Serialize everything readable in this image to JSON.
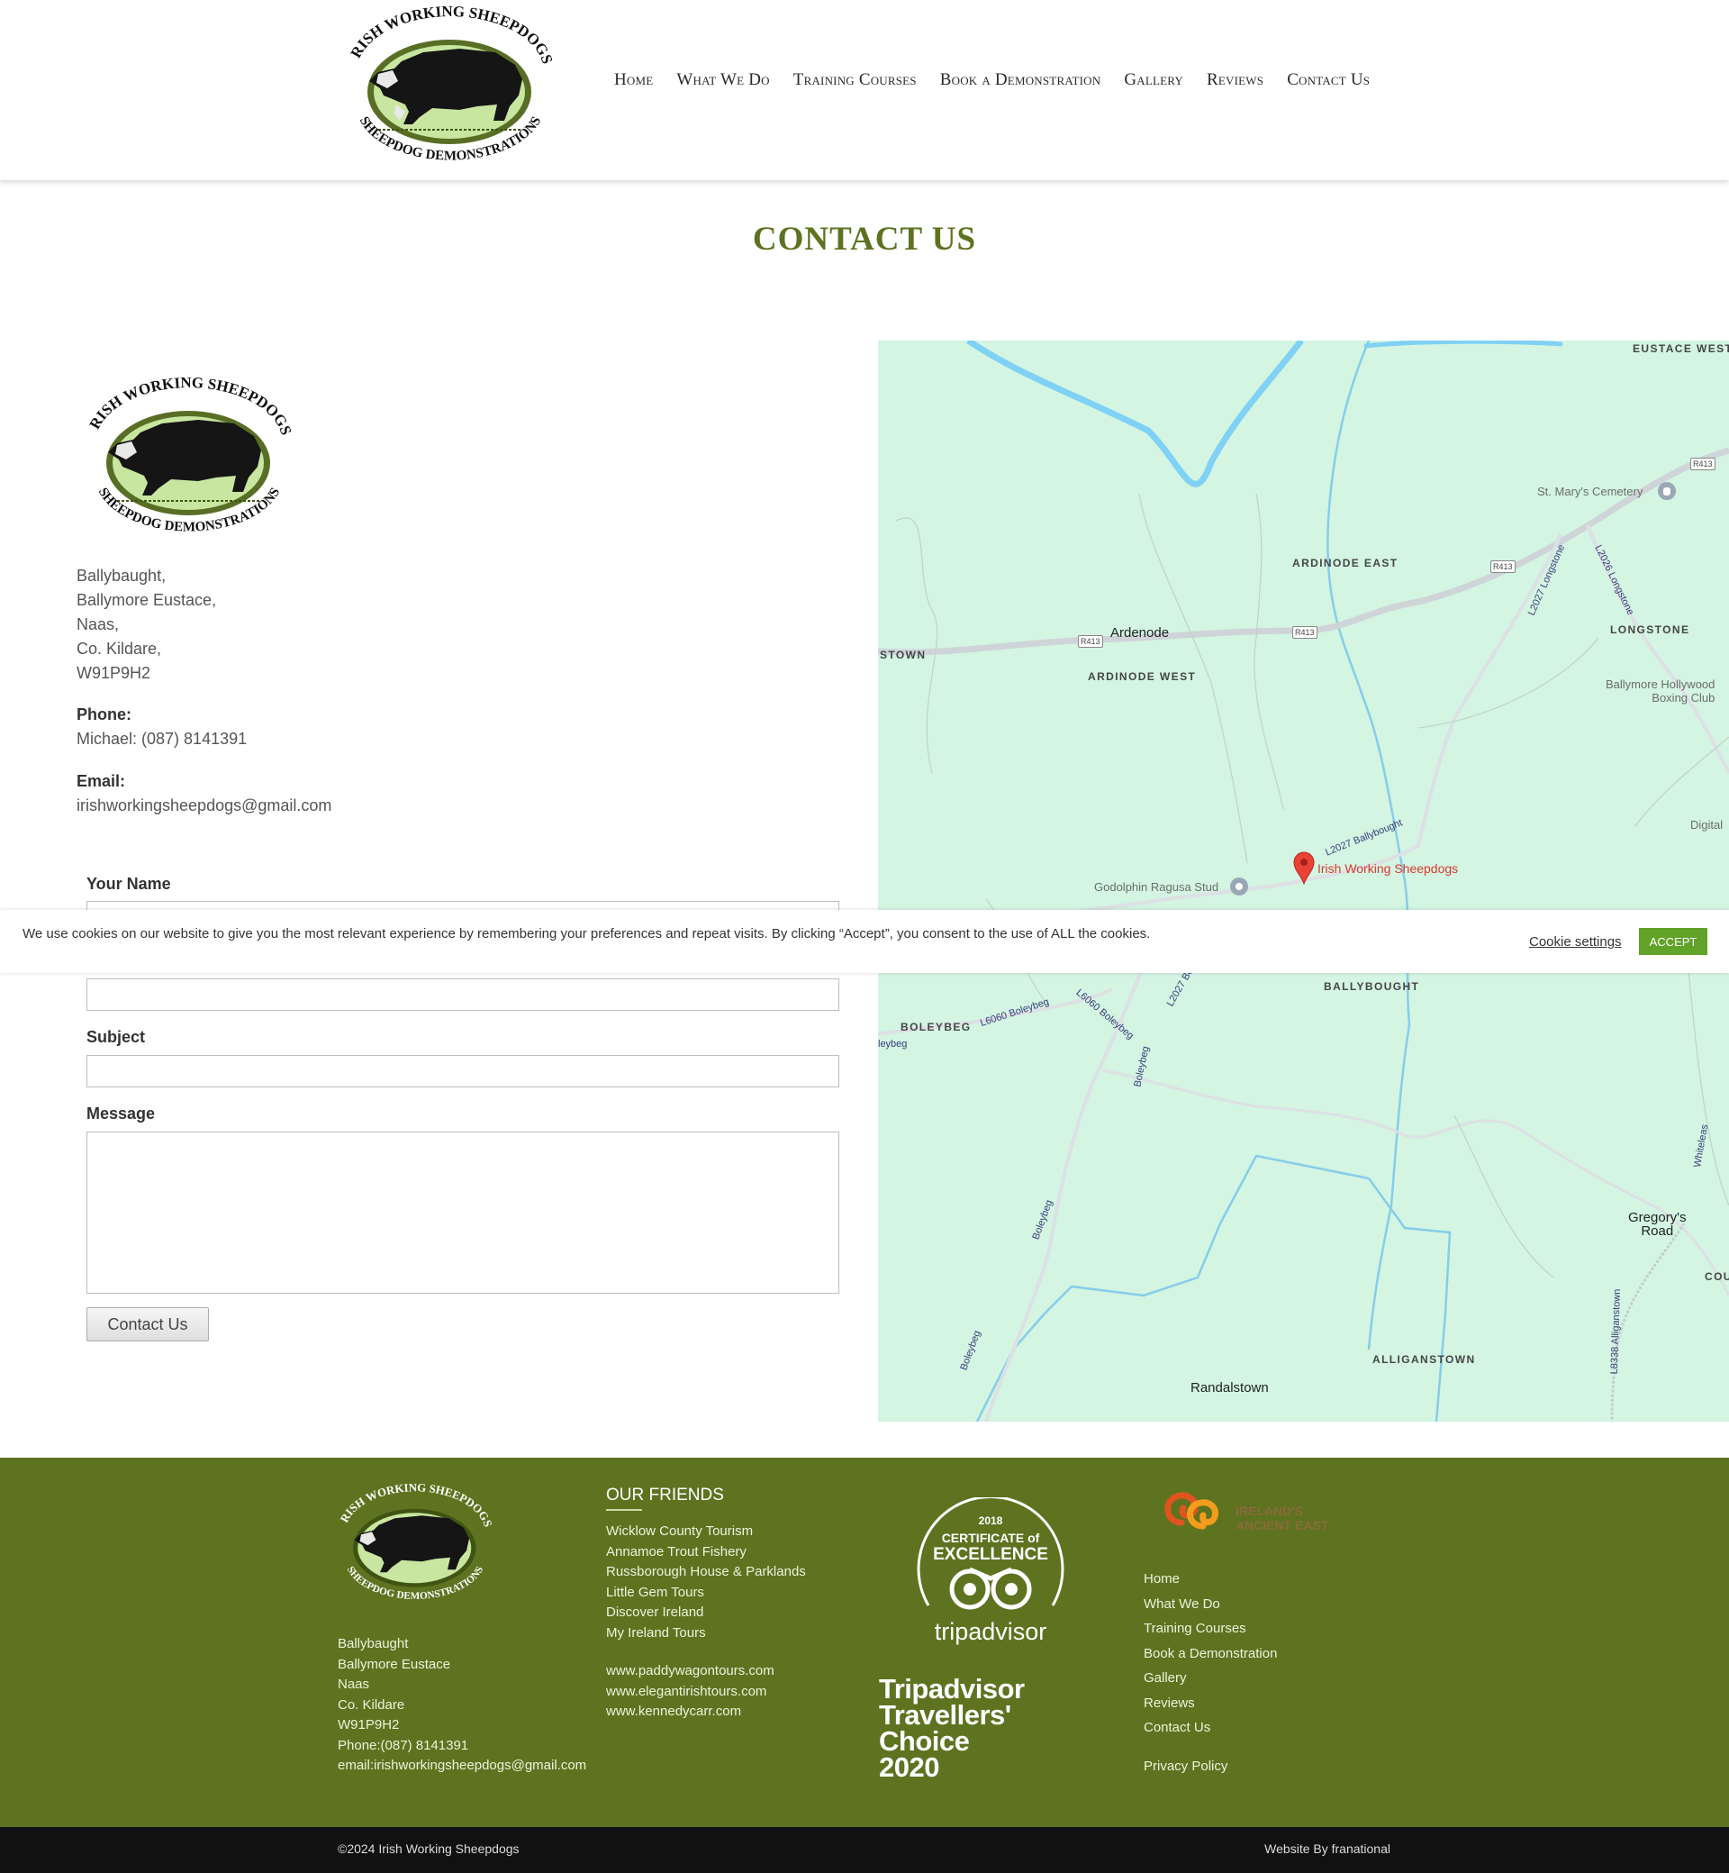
{
  "logo": {
    "top_text": "IRISH WORKING SHEEPDOGS",
    "bottom_text": "SHEEPDOG DEMONSTRATIONS"
  },
  "nav": [
    "Home",
    "What We Do",
    "Training Courses",
    "Book a Demonstration",
    "Gallery",
    "Reviews",
    "Contact Us"
  ],
  "page_title": "CONTACT US",
  "address": [
    "Ballybaught,",
    "Ballymore Eustace,",
    "Naas,",
    "Co. Kildare,",
    "W91P9H2"
  ],
  "phone": {
    "label": "Phone:",
    "value": "Michael: (087) 8141391"
  },
  "email": {
    "label": "Email:",
    "value": "irishworkingsheepdogs@gmail.com"
  },
  "form": {
    "name_label": "Your Name",
    "subject_label": "Subject",
    "message_label": "Message",
    "submit_label": "Contact Us"
  },
  "map": {
    "marker_label": "Irish Working Sheepdogs",
    "places": {
      "eustace_west": "EUSTACE WEST",
      "st_marys": "St. Mary's Cemetery",
      "ardinode_east": "ARDINODE EAST",
      "ardenode": "Ardenode",
      "stown": "STOWN",
      "ardinode_west": "ARDINODE WEST",
      "longstone": "LONGSTONE",
      "boxing_club_1": "Ballymore Hollywood",
      "boxing_club_2": "Boxing Club",
      "digital": "Digital",
      "godolphin": "Godolphin Ragusa Stud",
      "ballybought": "BALLYBOUGHT",
      "boleybeg": "BOLEYBEG",
      "gregorys_1": "Gregory's",
      "gregorys_2": "Road",
      "cou": "COU",
      "alliganstown": "ALLIGANSTOWN",
      "randalstown": "Randalstown",
      "leybeg": "leybeg"
    },
    "roads": {
      "l2027_ballybought": "L2027 Ballybought",
      "l2027_longstone": "L2027 Longstone",
      "l2026_longstone": "L2026 Longstone",
      "l6060_boleybeg": "L6060 Boleybeg",
      "l6060_boleybeg_2": "L6060 Boleybeg",
      "boleybeg_a": "Boleybeg",
      "boleybeg_b": "Boleybeg",
      "boleybeg_c": "Boleybeg",
      "l2027_bo": "L2027 Bo",
      "whiteleas": "Whiteleas",
      "l8338": "L8338 Alliganstown",
      "r413": "R413"
    }
  },
  "cookie": {
    "text": "We use cookies on our website to give you the most relevant experience by remembering your preferences and repeat visits. By clicking “Accept”, you consent to the use of ALL the cookies.",
    "settings": "Cookie settings",
    "accept": "ACCEPT"
  },
  "footer": {
    "address": [
      "Ballybaught",
      "Ballymore Eustace",
      "Naas",
      "Co. Kildare",
      "W91P9H2",
      "Phone:(087) 8141391",
      "email:irishworkingsheepdogs@gmail.com"
    ],
    "friends_heading": "OUR FRIENDS",
    "friends": [
      "Wicklow County Tourism",
      "Annamoe Trout Fishery",
      "Russborough House & Parklands",
      "Little Gem Tours",
      "Discover Ireland",
      "My Ireland Tours"
    ],
    "friend_links": [
      "www.paddywagontours.com",
      "www.elegantirishtours.com",
      "www.kennedycarr.com"
    ],
    "tripadvisor": {
      "year": "2018",
      "cert_1": "CERTIFICATE of",
      "cert_2": "EXCELLENCE",
      "brand": "tripadvisor",
      "tc_lines": [
        "Tripadvisor",
        "Travellers'",
        "Choice",
        "2020"
      ]
    },
    "ancient_east": [
      "IRELAND'S",
      "ANCIENT EAST"
    ],
    "nav": [
      "Home",
      "What We Do",
      "Training Courses",
      "Book a Demonstration",
      "Gallery",
      "Reviews",
      "Contact Us"
    ],
    "privacy": "Privacy Policy",
    "copyright": "©2024 Irish Working Sheepdogs",
    "credit": "Website By franational"
  },
  "colors": {
    "brand_green": "#5d7320",
    "accept_green": "#61a229",
    "map_bg": "#d3f5e2",
    "river": "#7fd1f5"
  }
}
